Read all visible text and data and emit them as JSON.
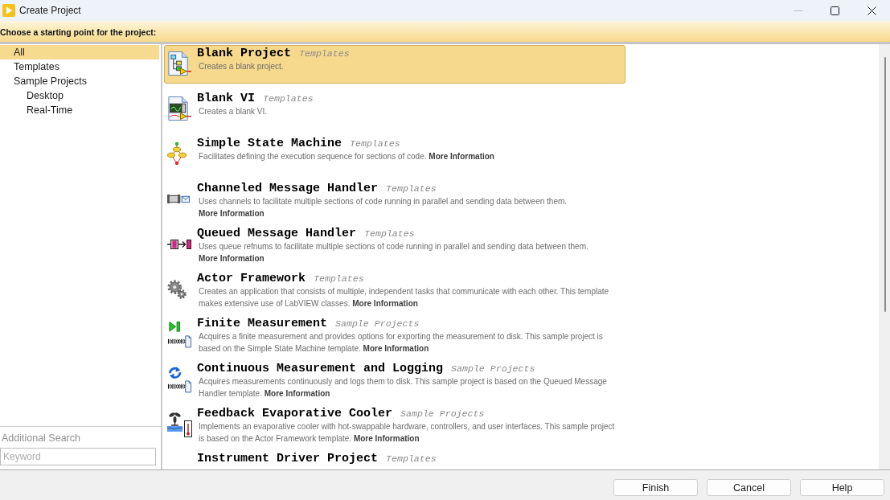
{
  "window": {
    "title": "Create Project",
    "controls": [
      {
        "kind": "minimize",
        "disabled": true
      },
      {
        "kind": "maximize",
        "disabled": false
      },
      {
        "kind": "close",
        "disabled": false
      }
    ]
  },
  "header": {
    "prompt": "Choose a starting point for the project:"
  },
  "sidebar": {
    "items": [
      {
        "label": "All",
        "selected": true
      },
      {
        "label": "Templates",
        "selected": false
      },
      {
        "label": "Sample Projects",
        "selected": false,
        "children": [
          {
            "label": "Desktop",
            "selected": false
          },
          {
            "label": "Real-Time",
            "selected": false
          }
        ]
      }
    ],
    "additional_search": {
      "label": "Additional Search",
      "placeholder": "Keyword"
    }
  },
  "templates": {
    "items": [
      {
        "kind": "project",
        "name": "Blank Project",
        "category": "Templates",
        "description": "Creates a blank project.",
        "selected": true
      },
      {
        "kind": "vi",
        "name": "Blank VI",
        "category": "Templates",
        "description": "Creates a blank VI.",
        "selected": false
      },
      {
        "kind": "statemachine",
        "name": "Simple State Machine",
        "category": "Templates",
        "description": "Facilitates defining the execution sequence for sections of code.",
        "link": "More Information",
        "selected": false
      },
      {
        "kind": "channel",
        "name": "Channeled Message Handler",
        "category": "Templates",
        "description": "Uses channels to facilitate multiple sections of code running in parallel and sending data between them.",
        "link": "More Information",
        "selected": false
      },
      {
        "kind": "queue",
        "name": "Queued Message Handler",
        "category": "Templates",
        "description": "Uses queue refnums to facilitate multiple sections of code running in parallel and sending data between them.",
        "link": "More Information",
        "selected": false
      },
      {
        "kind": "actor",
        "name": "Actor Framework",
        "category": "Templates",
        "description": "Creates an application that consists of multiple, independent tasks that communicate with each other. This template makes extensive use of LabVIEW classes.",
        "link": "More Information",
        "selected": false
      },
      {
        "kind": "finite",
        "name": "Finite Measurement",
        "category": "Sample Projects",
        "description": "Acquires a finite measurement and provides options for exporting the measurement to disk. This sample project is based on the Simple State Machine template.",
        "link": "More Information",
        "selected": false
      },
      {
        "kind": "continuous",
        "name": "Continuous Measurement and Logging",
        "category": "Sample Projects",
        "description": "Acquires measurements continuously and logs them to disk. This sample project is based on the Queued Message Handler template.",
        "link": "More Information",
        "selected": false
      },
      {
        "kind": "cooler",
        "name": "Feedback Evaporative Cooler",
        "category": "Sample Projects",
        "description": "Implements an evaporative cooler with hot-swappable hardware, controllers, and user interfaces. This sample project is based on the Actor Framework template.",
        "link": "More Information",
        "selected": false
      },
      {
        "name": "Instrument Driver Project",
        "category": "Templates",
        "selected": false
      }
    ]
  },
  "buttons": [
    {
      "label": "Finish"
    },
    {
      "label": "Cancel"
    },
    {
      "label": "Help"
    }
  ]
}
